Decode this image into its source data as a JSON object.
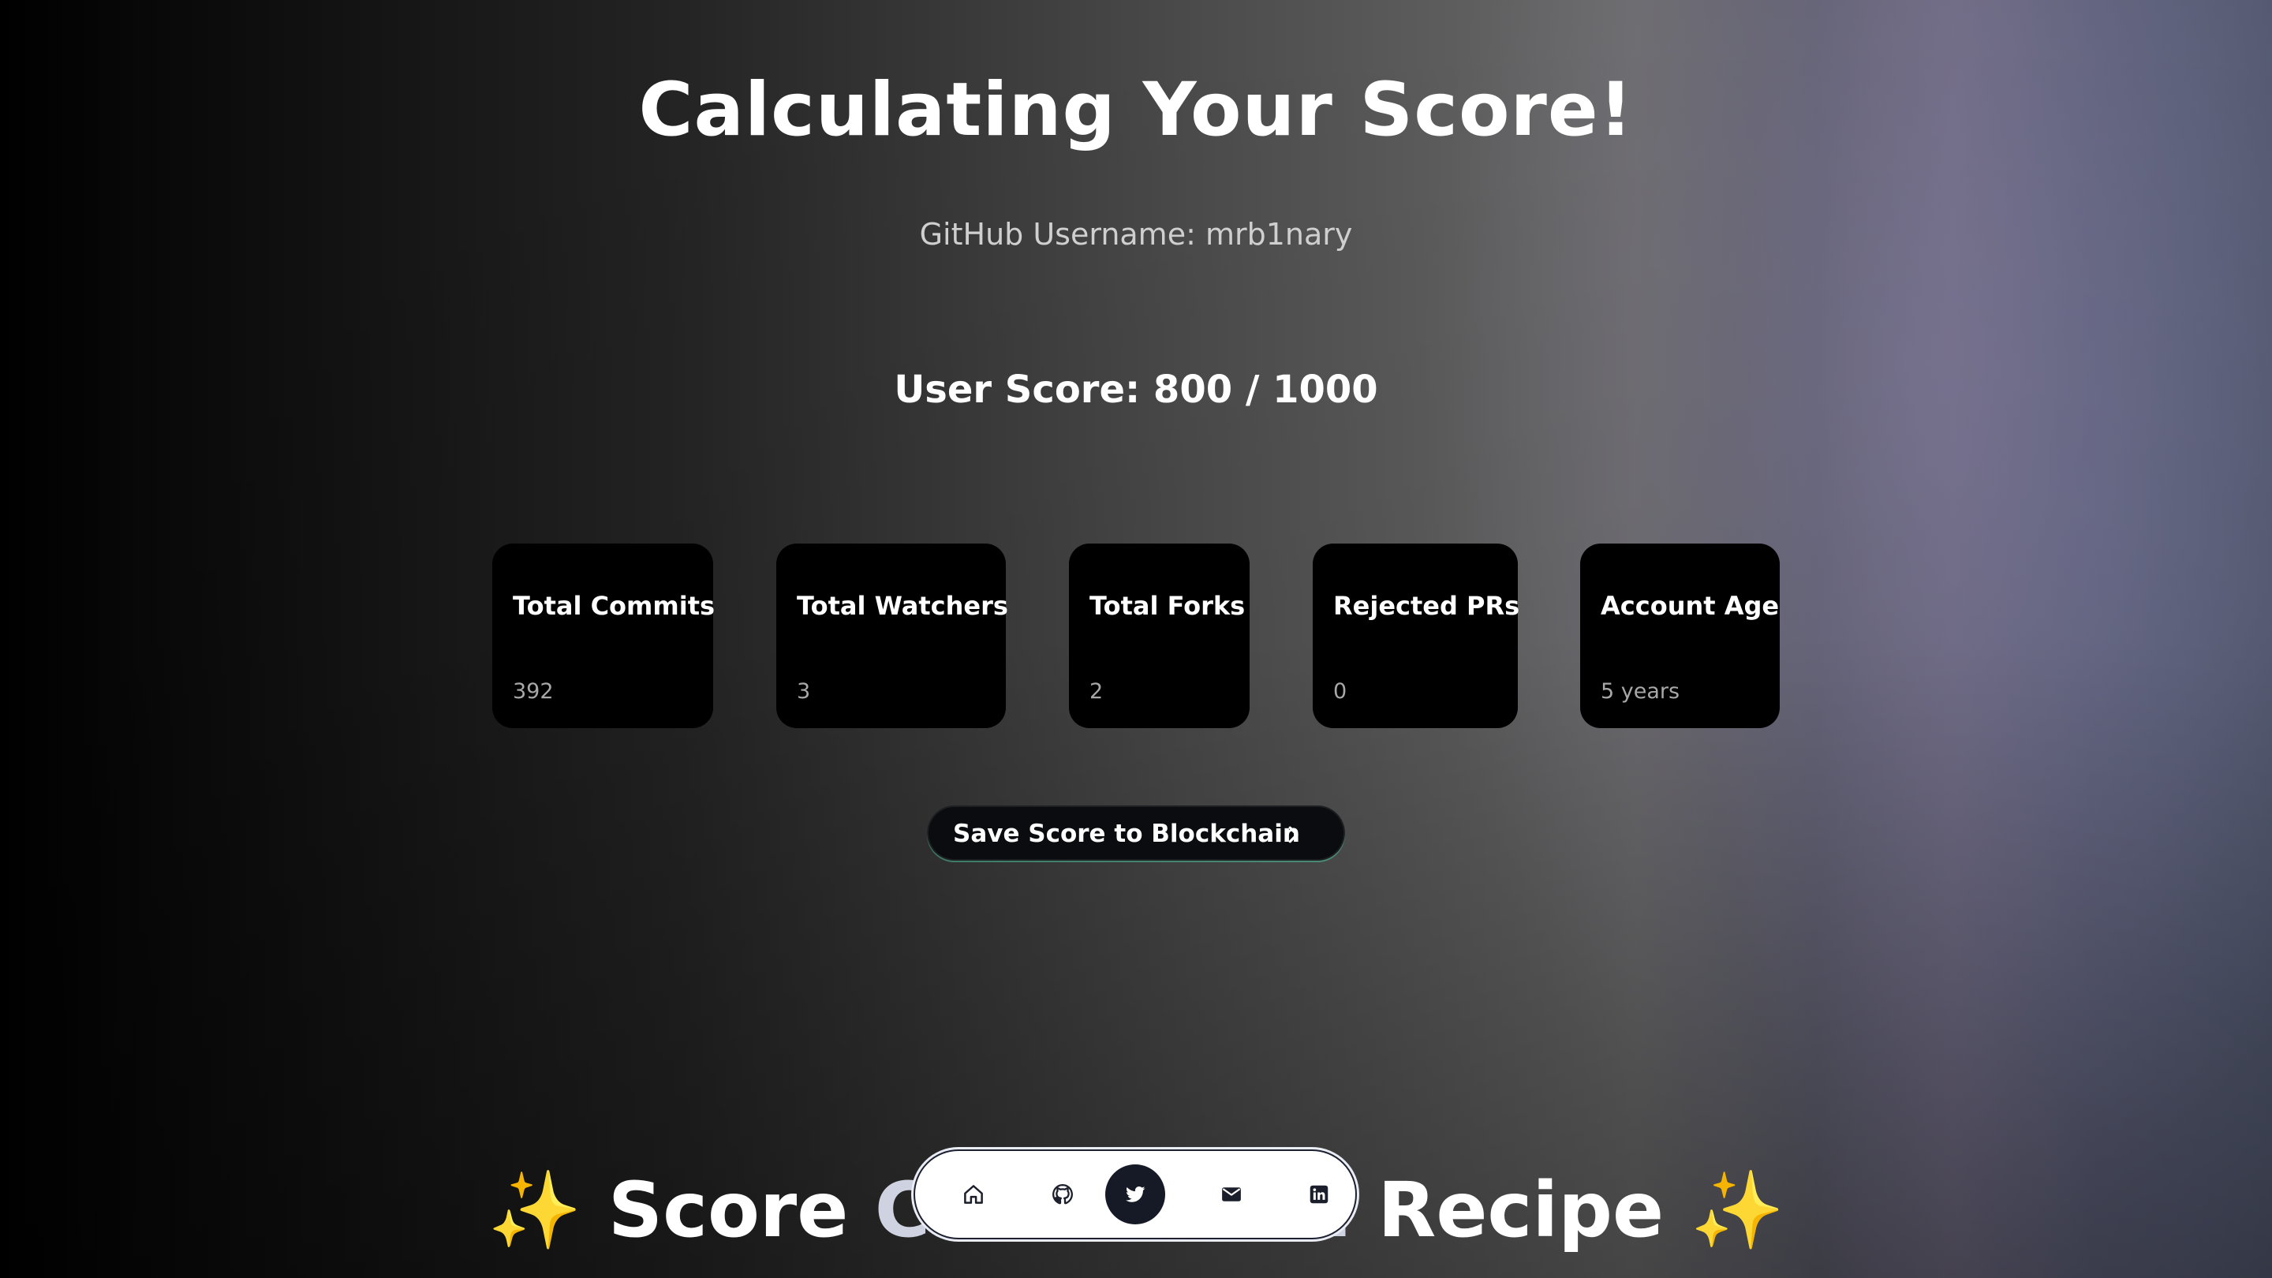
{
  "header": {
    "title": "Calculating Your Score!",
    "username_line": "GitHub Username: mrb1nary",
    "score_line": "User Score: 800 / 1000"
  },
  "stats": [
    {
      "label": "Total Commits",
      "value": "392"
    },
    {
      "label": "Total Watchers",
      "value": "3"
    },
    {
      "label": "Total Forks",
      "value": "2"
    },
    {
      "label": "Rejected PRs",
      "value": "0"
    },
    {
      "label": "Account Age",
      "value": "5 years"
    }
  ],
  "actions": {
    "save_label": "Save Score to Blockchain",
    "save_icon": "chevron-right-icon"
  },
  "recipe": {
    "left_emoji": "✨",
    "prefix": "Score",
    "hidden_part": "Calculation",
    "suffix": "Recipe",
    "right_emoji": "✨"
  },
  "dock": {
    "items": [
      {
        "icon": "home-icon"
      },
      {
        "icon": "github-icon"
      },
      {
        "icon": "twitter-icon",
        "active": true
      },
      {
        "icon": "mail-icon"
      },
      {
        "icon": "linkedin-icon"
      }
    ]
  },
  "colors": {
    "card_bg": "#000000",
    "dock_bg": "#ffffff",
    "dock_active": "#161a26",
    "button_bg": "#0b0c10",
    "button_glow": "#50dcaa"
  }
}
